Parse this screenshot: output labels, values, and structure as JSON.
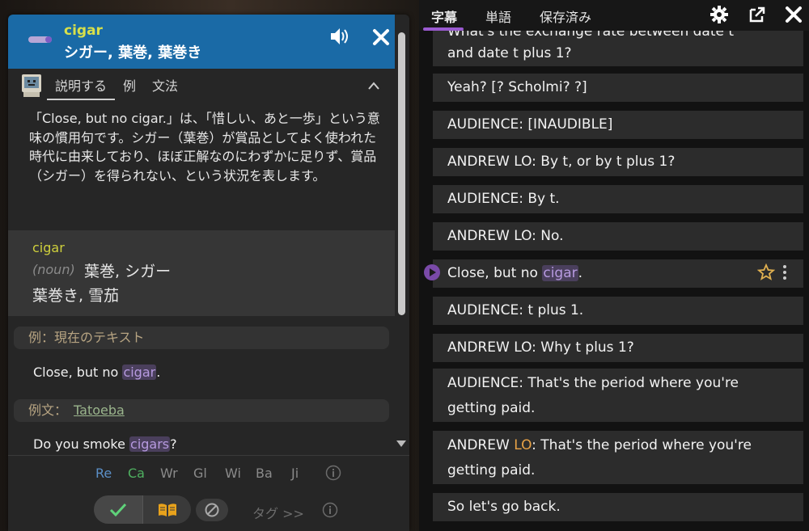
{
  "popup": {
    "word": "cigar",
    "reading": "シガー, 葉巻, 葉巻き",
    "tabs": [
      "説明する",
      "例",
      "文法"
    ],
    "explanation": "「Close, but no cigar.」は、「惜しい、あと一歩」という意味の慣用句です。シガー（葉巻）が賞品としてよく使われた時代に由来しており、ほぼ正解なのにわずかに足りず、賞品（シガー）を得られない、という状況を表します。",
    "definition": {
      "word": "cigar",
      "pos": "(noun)",
      "gloss1": "葉巻, シガー",
      "gloss2": "葉巻き, 雪茄"
    },
    "current_text_label": "例：現在のテキスト",
    "current_example": {
      "before": "Close, but no ",
      "hl": "cigar",
      "after": "."
    },
    "examples_label": "例文：",
    "examples_source": "Tatoeba",
    "example_sentence": {
      "before": "Do you smoke ",
      "hl": "cigars",
      "after": "?"
    },
    "dict_links": [
      "Re",
      "Ca",
      "Wr",
      "Gl",
      "Wi",
      "Ba",
      "Ji"
    ],
    "tag_label": "タグ >>",
    "colors": {
      "header": "#1a6aa6",
      "word": "#d8e04a",
      "highlight": "#b79ae0"
    }
  },
  "right": {
    "tabs": [
      "字幕",
      "単語",
      "保存済み"
    ],
    "lines": [
      {
        "text": "What's the exchange rate between date t",
        "text2": "and date t plus 1?"
      },
      {
        "text": "Yeah? [? Scholmi? ?]"
      },
      {
        "text": "AUDIENCE: [INAUDIBLE]"
      },
      {
        "text": "ANDREW LO: By t, or by t plus 1?"
      },
      {
        "text": "AUDIENCE: By t."
      },
      {
        "text": "ANDREW LO: No."
      },
      {
        "before": "Close, but no ",
        "hl": "cigar",
        "after": "."
      },
      {
        "text": "AUDIENCE: t plus 1."
      },
      {
        "text": "ANDREW LO: Why t plus 1?"
      },
      {
        "text": "AUDIENCE: That's the period where you're",
        "text2": "getting paid."
      },
      {
        "pre": "ANDREW ",
        "orange": "LO",
        "post": ": That's the period where you're",
        "text2": "getting paid."
      },
      {
        "text": "So let's go back."
      }
    ]
  }
}
